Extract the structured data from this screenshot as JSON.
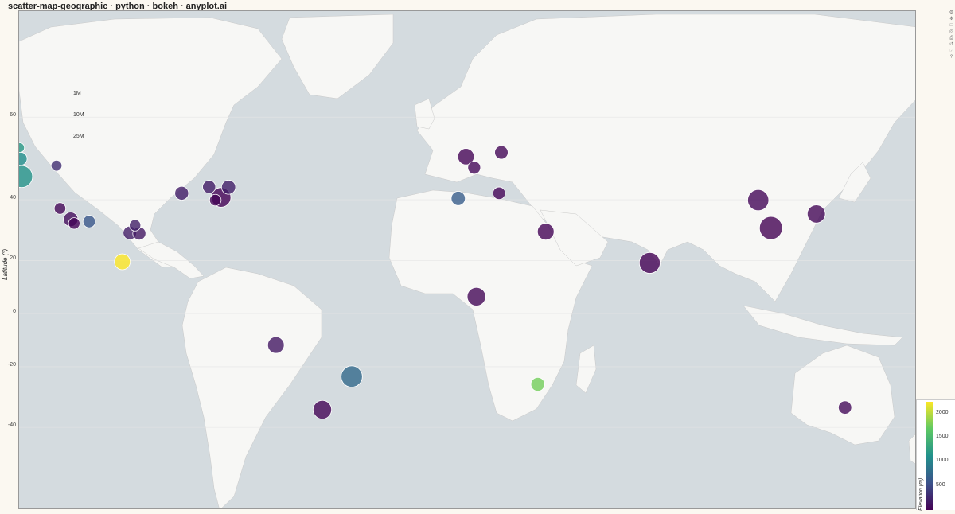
{
  "title": "scatter-map-geographic · python · bokeh · anyplot.ai",
  "colors": {
    "ocean": "#d4dbdf",
    "land": "#f7f7f5",
    "marker_edge": "#ffffff",
    "viridis": [
      "#440154",
      "#3b528b",
      "#21918c",
      "#5ec962",
      "#fde725"
    ]
  },
  "toolbar": {
    "icons": [
      "bokeh-logo-icon",
      "pan-icon",
      "box-zoom-icon",
      "wheel-zoom-icon",
      "save-icon",
      "reset-icon",
      "hover-icon",
      "help-icon"
    ]
  },
  "chart_data": {
    "type": "scatter",
    "title": "scatter-map-geographic · python · bokeh · anyplot.ai",
    "xlabel": "",
    "ylabel": "Latitude (°)",
    "xlim": [
      -180,
      180
    ],
    "ylim": [
      -60,
      75
    ],
    "yticks": [
      60,
      40,
      20,
      0,
      -20,
      -40
    ],
    "grid": true,
    "basemap": "light world map tiles",
    "size_legend": {
      "labels": [
        "1M",
        "10M",
        "25M"
      ],
      "values": [
        1,
        10,
        25
      ]
    },
    "colorbar": {
      "title": "Elevation (m)",
      "ticks": [
        2000,
        1500,
        1000,
        500
      ],
      "range": [
        0,
        2240
      ],
      "colormap": "viridis"
    },
    "points": [
      {
        "lat": 53.6,
        "lon": -179.8,
        "pop": 1.5,
        "elev": 1200
      },
      {
        "lat": 51.0,
        "lon": -179.4,
        "pop": 5.0,
        "elev": 1100
      },
      {
        "lat": 46.5,
        "lon": -179.0,
        "pop": 24.0,
        "elev": 1150
      },
      {
        "lat": 49.3,
        "lon": -165.0,
        "pop": 2.5,
        "elev": 300
      },
      {
        "lat": 43.6,
        "lon": -96.0,
        "pop": 6.5,
        "elev": 200
      },
      {
        "lat": 40.7,
        "lon": -99.0,
        "pop": 17.5,
        "elev": 10
      },
      {
        "lat": 39.9,
        "lon": -101.3,
        "pop": 3.2,
        "elev": 20
      },
      {
        "lat": 41.9,
        "lon": -114.8,
        "pop": 6.0,
        "elev": 180
      },
      {
        "lat": 43.7,
        "lon": -103.8,
        "pop": 5.0,
        "elev": 170
      },
      {
        "lat": 37.4,
        "lon": -163.6,
        "pop": 3.2,
        "elev": 40
      },
      {
        "lat": 34.0,
        "lon": -159.3,
        "pop": 7.2,
        "elev": 90
      },
      {
        "lat": 32.7,
        "lon": -157.9,
        "pop": 3.1,
        "elev": 20
      },
      {
        "lat": 33.3,
        "lon": -151.9,
        "pop": 4.2,
        "elev": 600
      },
      {
        "lat": 32.1,
        "lon": -133.5,
        "pop": 3.0,
        "elev": 200
      },
      {
        "lat": 29.6,
        "lon": -135.6,
        "pop": 5.5,
        "elev": 180
      },
      {
        "lat": 29.4,
        "lon": -131.8,
        "pop": 5.0,
        "elev": 150
      },
      {
        "lat": 19.5,
        "lon": -138.6,
        "pop": 9.5,
        "elev": 2240
      },
      {
        "lat": 51.5,
        "lon": -0.8,
        "pop": 10.5,
        "elev": 20
      },
      {
        "lat": 48.8,
        "lon": 2.5,
        "pop": 4.7,
        "elev": 50
      },
      {
        "lat": 52.5,
        "lon": 13.4,
        "pop": 5.5,
        "elev": 40
      },
      {
        "lat": 40.4,
        "lon": -3.9,
        "pop": 6.5,
        "elev": 650
      },
      {
        "lat": 41.9,
        "lon": 12.5,
        "pop": 4.2,
        "elev": 30
      },
      {
        "lat": 30.0,
        "lon": 31.2,
        "pop": 11.0,
        "elev": 20
      },
      {
        "lat": 6.5,
        "lon": 3.4,
        "pop": 15.0,
        "elev": 40
      },
      {
        "lat": -26.2,
        "lon": 28.0,
        "pop": 6.0,
        "elev": 1750
      },
      {
        "lat": 19.1,
        "lon": 72.9,
        "pop": 21.0,
        "elev": 14
      },
      {
        "lat": 39.9,
        "lon": 116.4,
        "pop": 21.5,
        "elev": 50
      },
      {
        "lat": 31.2,
        "lon": 121.5,
        "pop": 27.0,
        "elev": 5
      },
      {
        "lat": 35.7,
        "lon": 139.7,
        "pop": 14.0,
        "elev": 40
      },
      {
        "lat": -33.9,
        "lon": 151.2,
        "pop": 5.3,
        "elev": 60
      },
      {
        "lat": -12.0,
        "lon": -77.0,
        "pop": 10.8,
        "elev": 150
      },
      {
        "lat": -23.5,
        "lon": -46.6,
        "pop": 22.0,
        "elev": 760
      },
      {
        "lat": -34.6,
        "lon": -58.4,
        "pop": 15.0,
        "elev": 25
      }
    ]
  }
}
